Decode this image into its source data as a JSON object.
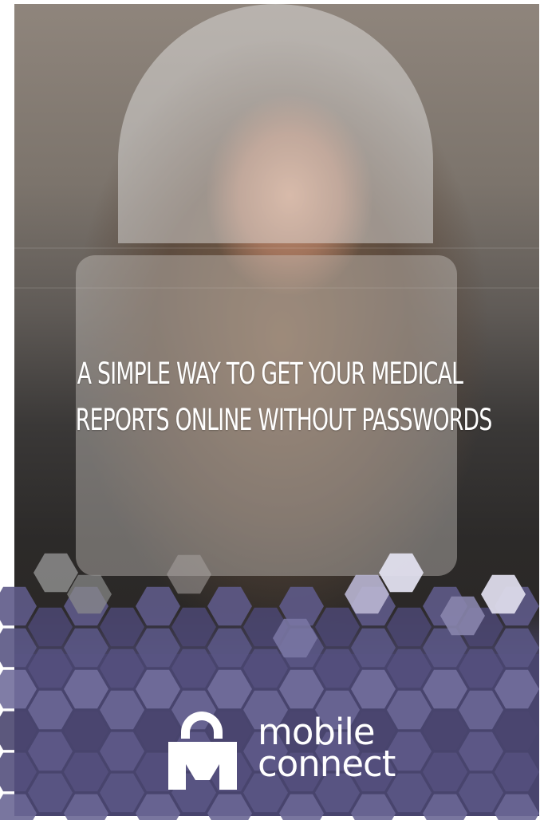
{
  "headline": {
    "line1": "A SIMPLE WAY TO GET YOUR MEDICAL",
    "line2": "REPORTS ONLINE WITHOUT PASSWORDS"
  },
  "brand": {
    "line1": "mobile",
    "line2": "connect",
    "logo_icon": "mobile-connect-padlock-icon"
  },
  "colors": {
    "text": "#ffffff",
    "hex_purple": "#6a6795",
    "hex_light": "#d8d6e8",
    "footer": "#46426c"
  }
}
